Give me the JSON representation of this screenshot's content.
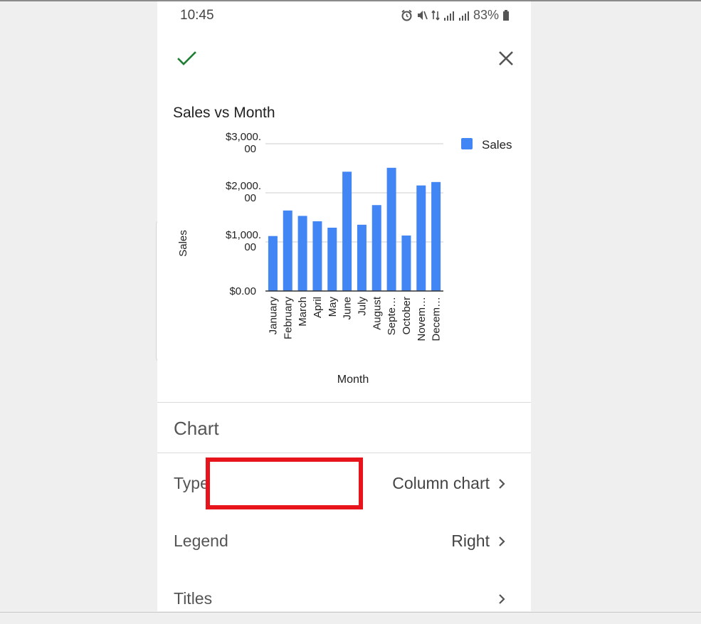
{
  "status_bar": {
    "time": "10:45",
    "battery": "83%",
    "icons": [
      "alarm-icon",
      "mute-icon",
      "data-arrows-icon",
      "signal-icon",
      "signal-roaming-icon",
      "battery-icon"
    ]
  },
  "toolbar": {
    "confirm_icon": "check-icon",
    "close_icon": "close-icon"
  },
  "chart_data": {
    "type": "bar",
    "title": "Sales vs Month",
    "xlabel": "Month",
    "ylabel": "Sales",
    "categories": [
      "January",
      "February",
      "March",
      "April",
      "May",
      "June",
      "July",
      "August",
      "Septe…",
      "October",
      "Novem…",
      "Decem…"
    ],
    "series": [
      {
        "name": "Sales",
        "values": [
          1120,
          1640,
          1530,
          1420,
          1290,
          2430,
          1350,
          1750,
          2510,
          1130,
          2150,
          2220
        ]
      }
    ],
    "ylim": [
      0,
      3000
    ],
    "yticks": [
      {
        "value": 0,
        "line1": "$0.00",
        "line2": ""
      },
      {
        "value": 1000,
        "line1": "$1,000.",
        "line2": "00"
      },
      {
        "value": 2000,
        "line1": "$2,000.",
        "line2": "00"
      },
      {
        "value": 3000,
        "line1": "$3,000.",
        "line2": "00"
      }
    ],
    "legend_position": "right",
    "grid": true,
    "color": "#4285f4"
  },
  "editor": {
    "section_title": "Chart",
    "rows": [
      {
        "label": "Type",
        "value": "Column chart"
      },
      {
        "label": "Legend",
        "value": "Right"
      },
      {
        "label": "Titles",
        "value": ""
      }
    ]
  },
  "colors": {
    "accent_check": "#1e7e34",
    "highlight": "#e8141b",
    "bar": "#4285f4"
  }
}
